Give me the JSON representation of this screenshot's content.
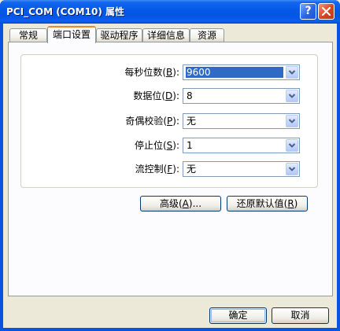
{
  "window": {
    "title": "PCI_COM (COM10) 属性",
    "help_label": "?",
    "close_icon": "close-icon"
  },
  "tabs": [
    {
      "label": "常规",
      "active": false
    },
    {
      "label": "端口设置",
      "active": true
    },
    {
      "label": "驱动程序",
      "active": false
    },
    {
      "label": "详细信息",
      "active": false
    },
    {
      "label": "资源",
      "active": false
    }
  ],
  "port_settings": {
    "fields": [
      {
        "label_pre": "每秒位数(",
        "accel": "B",
        "label_post": "):",
        "value": "9600",
        "focused": true
      },
      {
        "label_pre": "数据位(",
        "accel": "D",
        "label_post": "):",
        "value": "8",
        "focused": false
      },
      {
        "label_pre": "奇偶校验(",
        "accel": "P",
        "label_post": "):",
        "value": "无",
        "focused": false
      },
      {
        "label_pre": "停止位(",
        "accel": "S",
        "label_post": "):",
        "value": "1",
        "focused": false
      },
      {
        "label_pre": "流控制(",
        "accel": "F",
        "label_post": "):",
        "value": "无",
        "focused": false
      }
    ],
    "dropdown_icon": "chevron-down-icon",
    "advanced_button": {
      "pre": "高级(",
      "accel": "A",
      "post": ")..."
    },
    "restore_button": {
      "pre": "还原默认值(",
      "accel": "R",
      "post": ")"
    }
  },
  "footer": {
    "ok_label": "确定",
    "cancel_label": "取消"
  },
  "colors": {
    "title_bar": "#0558E6",
    "close_button": "#D5451F",
    "selection": "#316AC5",
    "active_tab_accent": "#E68B2C",
    "dialog_background": "#ECE9D8"
  }
}
